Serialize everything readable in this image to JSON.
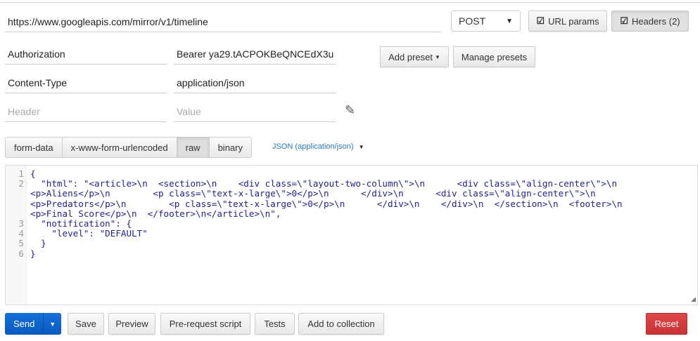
{
  "request": {
    "url": "https://www.googleapis.com/mirror/v1/timeline",
    "method": "POST",
    "url_params_label": "URL params",
    "headers_label": "Headers (2)"
  },
  "headers": {
    "rows": [
      {
        "key": "Authorization",
        "value": "Bearer ya29.tACPOKBeQNCEdX3u"
      },
      {
        "key": "Content-Type",
        "value": "application/json"
      }
    ],
    "key_placeholder": "Header",
    "value_placeholder": "Value",
    "add_preset_label": "Add preset",
    "manage_presets_label": "Manage presets"
  },
  "body": {
    "tabs": [
      "form-data",
      "x-www-form-urlencoded",
      "raw",
      "binary"
    ],
    "active_tab": "raw",
    "format": "JSON (application/json)",
    "code_rows": [
      {
        "num": "1",
        "text": "{"
      },
      {
        "num": "2",
        "text": "  \"html\": \"<article>\\n  <section>\\n    <div class=\\\"layout-two-column\\\">\\n      <div class=\\\"align-center\\\">\\n"
      },
      {
        "num": "",
        "text": "<p>Aliens</p>\\n        <p class=\\\"text-x-large\\\">0</p>\\n      </div>\\n      <div class=\\\"align-center\\\">\\n"
      },
      {
        "num": "",
        "text": "<p>Predators</p>\\n        <p class=\\\"text-x-large\\\">0</p>\\n      </div>\\n    </div>\\n  </section>\\n  <footer>\\n"
      },
      {
        "num": "",
        "text": "<p>Final Score</p>\\n  </footer>\\n</article>\\n\","
      },
      {
        "num": "3",
        "text": "  \"notification\": {"
      },
      {
        "num": "4",
        "text": "    \"level\": \"DEFAULT\""
      },
      {
        "num": "5",
        "text": "  }"
      },
      {
        "num": "6",
        "text": "}"
      }
    ]
  },
  "actions": {
    "send": "Send",
    "save": "Save",
    "preview": "Preview",
    "prerequest": "Pre-request script",
    "tests": "Tests",
    "add_to_collection": "Add to collection",
    "reset": "Reset"
  },
  "colors": {
    "send": "#0d63c9",
    "reset": "#d23c3c",
    "link": "#2a7ab8"
  }
}
